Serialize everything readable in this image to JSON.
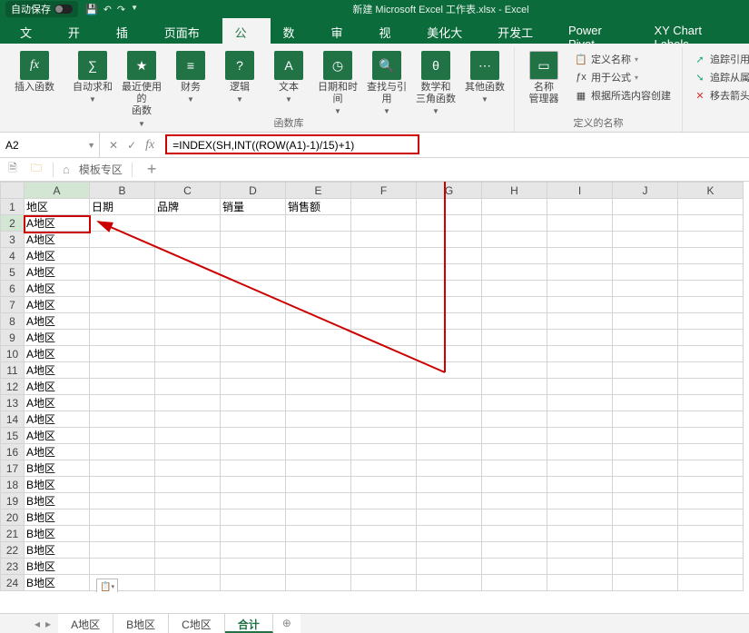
{
  "title_bar": {
    "autosave": "自动保存",
    "doc_title": "新建 Microsoft Excel 工作表.xlsx - Excel"
  },
  "tabs": [
    "文件",
    "开始",
    "插入",
    "页面布局",
    "公式",
    "数据",
    "审阅",
    "视图",
    "美化大师",
    "开发工具",
    "Power Pivot",
    "XY Chart Labels"
  ],
  "active_tab_index": 4,
  "ribbon": {
    "insert_fn": "插入函数",
    "autosum": "自动求和",
    "recent": "最近使用的\n函数",
    "financial": "财务",
    "logical": "逻辑",
    "text": "文本",
    "datetime": "日期和时间",
    "lookup": "查找与引用",
    "math": "数学和\n三角函数",
    "more": "其他函数",
    "lib_label": "函数库",
    "name_mgr": "名称\n管理器",
    "def_name": "定义名称",
    "use_formula": "用于公式",
    "create_sel": "根据所选内容创建",
    "defnames_label": "定义的名称",
    "trace_prec": "追踪引用单",
    "trace_dep": "追踪从属单",
    "remove_arrows": "移去箭头"
  },
  "formula_bar": {
    "cell_ref": "A2",
    "formula": "=INDEX(SH,INT((ROW(A1)-1)/15)+1)"
  },
  "templates_bar": {
    "label": "模板专区"
  },
  "columns": [
    "A",
    "B",
    "C",
    "D",
    "E",
    "F",
    "G",
    "H",
    "I",
    "J",
    "K"
  ],
  "headers_row": [
    "地区",
    "日期",
    "品牌",
    "销量",
    "销售额",
    "",
    "",
    "",
    "",
    "",
    ""
  ],
  "data_rows": [
    "A地区",
    "A地区",
    "A地区",
    "A地区",
    "A地区",
    "A地区",
    "A地区",
    "A地区",
    "A地区",
    "A地区",
    "A地区",
    "A地区",
    "A地区",
    "A地区",
    "A地区",
    "B地区",
    "B地区",
    "B地区",
    "B地区",
    "B地区",
    "B地区",
    "B地区",
    "B地区"
  ],
  "sheet_tabs": [
    "A地区",
    "B地区",
    "C地区",
    "合计"
  ],
  "active_sheet_index": 3
}
